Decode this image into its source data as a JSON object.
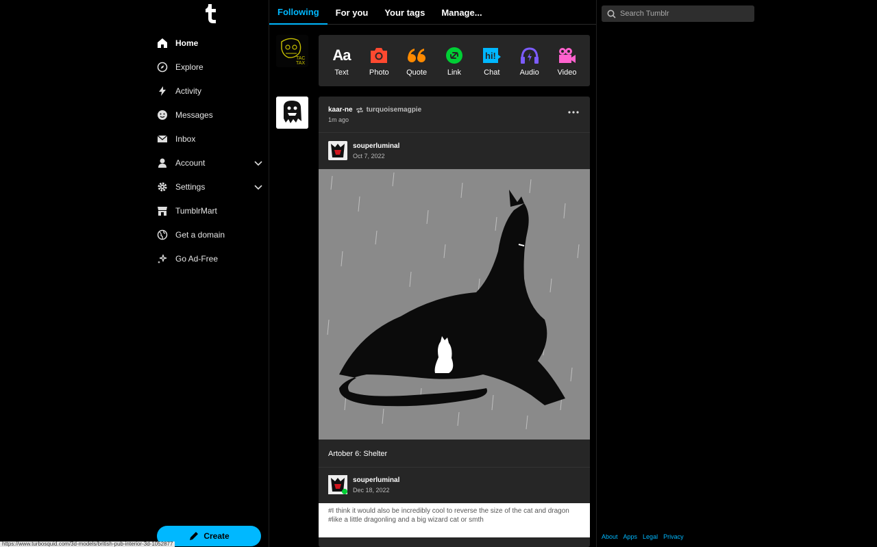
{
  "nav": {
    "items": [
      {
        "label": "Home",
        "icon": "home-icon"
      },
      {
        "label": "Explore",
        "icon": "compass-icon"
      },
      {
        "label": "Activity",
        "icon": "bolt-icon"
      },
      {
        "label": "Messages",
        "icon": "smiley-icon"
      },
      {
        "label": "Inbox",
        "icon": "envelope-icon"
      },
      {
        "label": "Account",
        "icon": "person-icon"
      },
      {
        "label": "Settings",
        "icon": "gear-icon"
      },
      {
        "label": "TumblrMart",
        "icon": "store-icon"
      },
      {
        "label": "Get a domain",
        "icon": "globe-icon"
      },
      {
        "label": "Go Ad-Free",
        "icon": "sparkle-icon"
      }
    ],
    "create_label": "Create"
  },
  "tabs": [
    "Following",
    "For you",
    "Your tags",
    "Manage..."
  ],
  "composer": [
    {
      "label": "Text",
      "color": "#ffffff"
    },
    {
      "label": "Photo",
      "color": "#ff4930"
    },
    {
      "label": "Quote",
      "color": "#ff8a00"
    },
    {
      "label": "Link",
      "color": "#00cf35"
    },
    {
      "label": "Chat",
      "color": "#00b8ff"
    },
    {
      "label": "Audio",
      "color": "#7c5cff"
    },
    {
      "label": "Video",
      "color": "#ff62ce"
    }
  ],
  "avatar_me": {
    "line1": "TAC",
    "line2": "TAX"
  },
  "post": {
    "author": "kaar-ne",
    "reblogged_from": "turquoisemagpie",
    "time": "1m ago",
    "trail1": {
      "name": "souperluminal",
      "date": "Oct 7, 2022"
    },
    "caption": "Artober 6: Shelter",
    "trail2": {
      "name": "souperluminal",
      "date": "Dec 18, 2022"
    },
    "tags": [
      "#I think it would also be incredibly cool to reverse the size of the cat and dragon",
      "#like a little dragonling and a big wizard cat or smth"
    ]
  },
  "search": {
    "placeholder": "Search Tumblr"
  },
  "footer": [
    "About",
    "Apps",
    "Legal",
    "Privacy"
  ],
  "status_url": "https://www.turbosquid.com/3d-models/british-pub-interior-3d-1052877",
  "colors": {
    "accent": "#00b8ff",
    "bg": "#000000",
    "card": "#262626"
  }
}
